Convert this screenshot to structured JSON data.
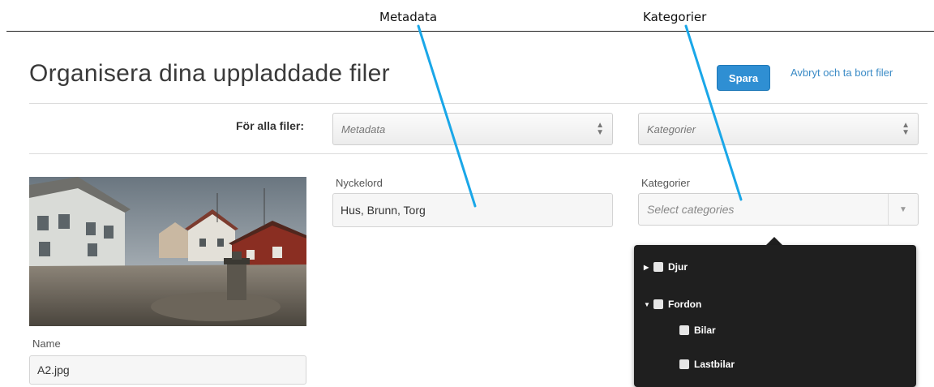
{
  "annotations": {
    "metadata_label": "Metadata",
    "categories_label": "Kategorier"
  },
  "page": {
    "title": "Organisera dina uppladdade filer",
    "save_label": "Spara",
    "cancel_label": "Avbryt och ta bort filer"
  },
  "bulk": {
    "label": "För alla filer:",
    "metadata_select": "Metadata",
    "categories_select": "Kategorier"
  },
  "file": {
    "name_label": "Name",
    "name_value": "A2.jpg",
    "keywords_label": "Nyckelord",
    "keywords_value": "Hus, Brunn, Torg",
    "categories_label": "Kategorier",
    "categories_placeholder": "Select categories"
  },
  "category_tree": [
    {
      "label": "Djur",
      "expanded": false,
      "level": 0
    },
    {
      "label": "Fordon",
      "expanded": true,
      "level": 0
    },
    {
      "label": "Bilar",
      "level": 1
    },
    {
      "label": "Lastbilar",
      "level": 1
    }
  ],
  "colors": {
    "accent": "#2f8fd3",
    "link": "#3b8bc6",
    "annotation_line": "#1aa7e8",
    "dropdown_bg": "#1f1f1f"
  }
}
